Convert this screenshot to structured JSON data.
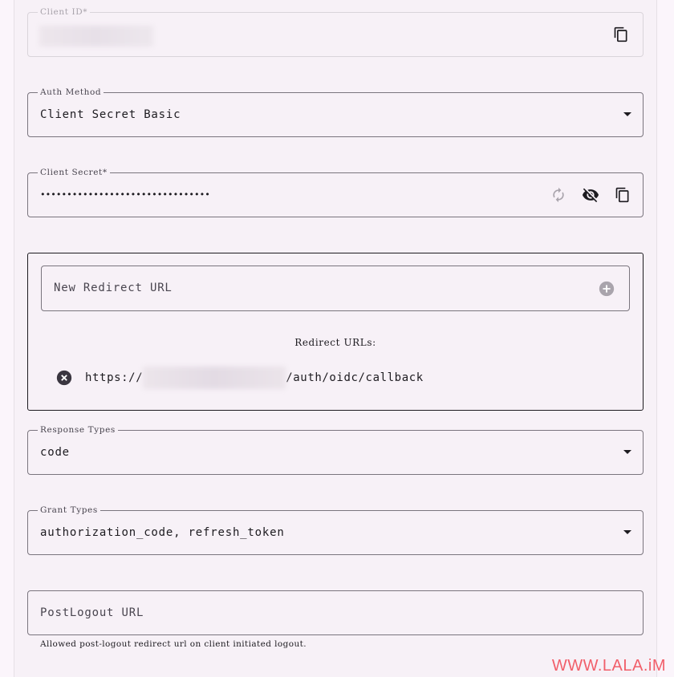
{
  "client_id": {
    "label": "Client ID*"
  },
  "auth_method": {
    "label": "Auth Method",
    "value": "Client Secret Basic"
  },
  "client_secret": {
    "label": "Client Secret*",
    "value": "••••••••••••••••••••••••••••••••"
  },
  "redirect": {
    "placeholder": "New Redirect URL",
    "list_title": "Redirect URLs:",
    "urls": [
      {
        "prefix": "https://",
        "suffix": "/auth/oidc/callback"
      }
    ]
  },
  "response_types": {
    "label": "Response Types",
    "value": "code"
  },
  "grant_types": {
    "label": "Grant Types",
    "value": "authorization_code, refresh_token"
  },
  "post_logout": {
    "placeholder": "PostLogout URL",
    "helper": "Allowed post-logout redirect url on client initiated logout."
  },
  "watermark": "WWW.LALA.iM",
  "icons": {
    "copy": "copy-icon",
    "refresh": "refresh-icon",
    "visibility_off": "visibility-off-icon",
    "add": "add-circle-icon",
    "remove": "cancel-circle-icon",
    "dropdown": "arrow-drop-down-icon"
  },
  "colors": {
    "text": "#1d1b20",
    "muted": "#49454f",
    "border": "#7a757e",
    "watermark": "#f15f6a"
  }
}
